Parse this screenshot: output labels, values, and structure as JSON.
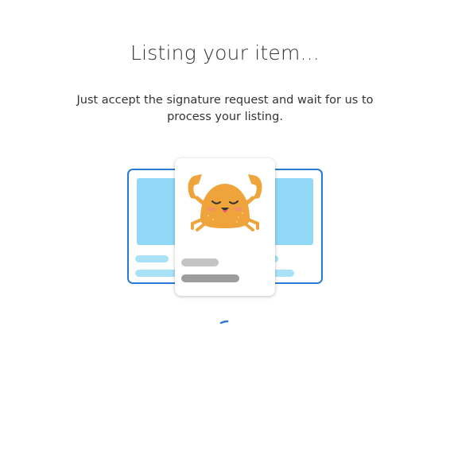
{
  "dialog": {
    "title": "Listing your item...",
    "subtitle": "Just accept the signature request and wait for us to process your listing."
  },
  "illustration": {
    "mascot_icon": "crab-icon",
    "colors": {
      "card_border": "#2a7bd6",
      "card_image": "#90d8f6",
      "card_line": "#a9e1f7",
      "front_line_light": "#c4c4c4",
      "front_line_dark": "#9d9d9d",
      "crab": "#eea43a",
      "spinner": "#2a7bd6"
    }
  },
  "loader": {
    "icon": "loading-spinner-icon"
  }
}
